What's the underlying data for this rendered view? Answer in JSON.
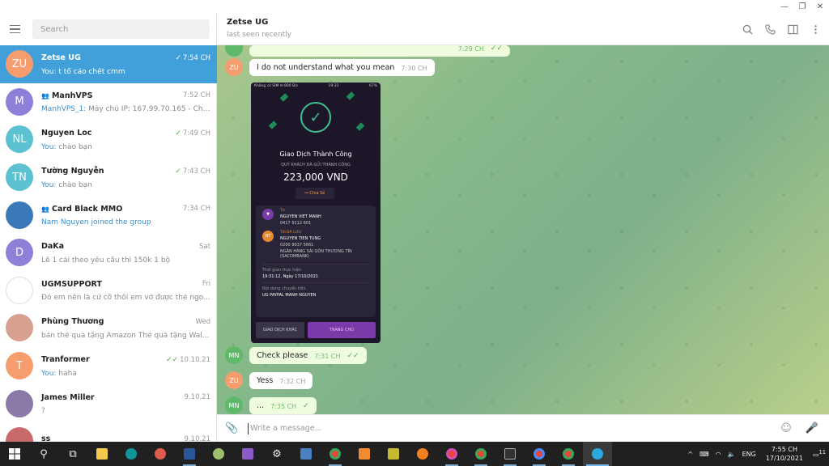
{
  "window": {
    "minimize": "—",
    "maximize": "❐",
    "close": "✕"
  },
  "left": {
    "search_placeholder": "Search",
    "chats": [
      {
        "initials": "ZU",
        "color": "#f59d6f",
        "name": "Zetse UG",
        "time": "7:54 CH",
        "checks": "✓",
        "who": "You:",
        "preview": " t tổ cảo chết cmm",
        "active": true,
        "group": false
      },
      {
        "initials": "M",
        "color": "#8e80d8",
        "name": "ManhVPS",
        "time": "7:52 CH",
        "checks": "",
        "who": "ManhVPS_1:",
        "preview": " Máy chủ IP: 167.99.70.165 - Chec...",
        "active": false,
        "group": true
      },
      {
        "initials": "NL",
        "color": "#5cc1d1",
        "name": "Nguyen Loc",
        "time": "7:49 CH",
        "checks": "✓",
        "who": "You:",
        "preview": " chào bạn",
        "active": false,
        "group": false
      },
      {
        "initials": "TN",
        "color": "#5cc1d1",
        "name": "Tường Nguyễn",
        "time": "7:43 CH",
        "checks": "✓",
        "who": "You:",
        "preview": " chào bạn",
        "active": false,
        "group": false
      },
      {
        "initials": "",
        "color": "#3a78b8",
        "name": "Card Black MMO",
        "time": "7:34 CH",
        "checks": "",
        "who": "",
        "preview": "Nam Nguyen joined the group",
        "active": false,
        "group": true,
        "preview_link": true
      },
      {
        "initials": "D",
        "color": "#8e80d8",
        "name": "DaKa",
        "time": "Sat",
        "checks": "",
        "who": "",
        "preview": "Lễ 1 cái theo yêu cầu thì 150k 1 bộ",
        "active": false,
        "group": false
      },
      {
        "initials": "",
        "color": "#ffffff",
        "name": "UGMSUPPORT",
        "time": "Fri",
        "checks": "",
        "who": "",
        "preview": "Đó em nên là cứ cố thôi em vớ được thẻ ngo...",
        "active": false,
        "group": false
      },
      {
        "initials": "",
        "color": "#d8a090",
        "name": "Phùng Thương",
        "time": "Wed",
        "checks": "",
        "who": "",
        "preview": "bán thẻ quà tặng Amazon Thẻ quà tặng Wal...",
        "active": false,
        "group": false
      },
      {
        "initials": "T",
        "color": "#f59d6f",
        "name": "Tranformer",
        "time": "10.10.21",
        "checks": "✓✓",
        "who": "You:",
        "preview": " haha",
        "active": false,
        "group": false
      },
      {
        "initials": "",
        "color": "#8a7aa8",
        "name": "James Miller",
        "time": "9.10.21",
        "checks": "",
        "who": "",
        "preview": "?",
        "active": false,
        "group": false
      },
      {
        "initials": "",
        "color": "#c96a6a",
        "name": "ss",
        "time": "9.10.21",
        "checks": "",
        "who": "",
        "preview": "",
        "active": false,
        "group": false
      }
    ]
  },
  "header": {
    "title": "Zetse UG",
    "status": "last seen recently"
  },
  "messages": {
    "m1": {
      "avatar": "ZU",
      "text": "I do not understand what you mean",
      "time": "7:30 CH"
    },
    "m_top_time": "7:29 CH",
    "m2": {
      "avatar": "MN",
      "text": "Check please",
      "time": "7:31 CH"
    },
    "m3": {
      "avatar": "ZU",
      "text": "Yess",
      "time": "7:32 CH"
    },
    "m4": {
      "avatar": "MN",
      "text": "...",
      "time": "7:35 CH"
    }
  },
  "receipt": {
    "status_left": "Không có SIM ✉ 800 B/s",
    "status_mid": "19:31",
    "status_right": "67%",
    "title": "Giao Dịch Thành Công",
    "subtitle": "QUÝ KHÁCH ĐÃ GỬI THÀNH CÔNG",
    "amount": "223,000 VND",
    "share": "Chia Sẻ",
    "from_label": "Từ",
    "from_name": "NGUYEN VIET MANH",
    "from_acc": "0417 9112 601",
    "to_label": "Tới  ĐÃ LƯU",
    "to_name": "NGUYEN TIEN TUNG",
    "to_acc": "0200 9037 5661",
    "to_bank": "NGÂN HÀNG SÀI GÒN THƯƠNG TÍN (SACOMBANK)",
    "to_initials": "NT",
    "time_label": "Thời gian thực hiện",
    "time_value": "19:31:12, Ngày 17/10/2021",
    "content_label": "Nội dung chuyển tiền",
    "content_value": "UG PAYPAL MANH NGUYEN",
    "btn_other": "GIAO DỊCH KHÁC",
    "btn_home": "TRANG CHỦ"
  },
  "compose": {
    "placeholder": "Write a message..."
  },
  "taskbar": {
    "lang": "ENG",
    "clock_time": "7:55 CH",
    "clock_date": "17/10/2021",
    "notif": "11"
  }
}
